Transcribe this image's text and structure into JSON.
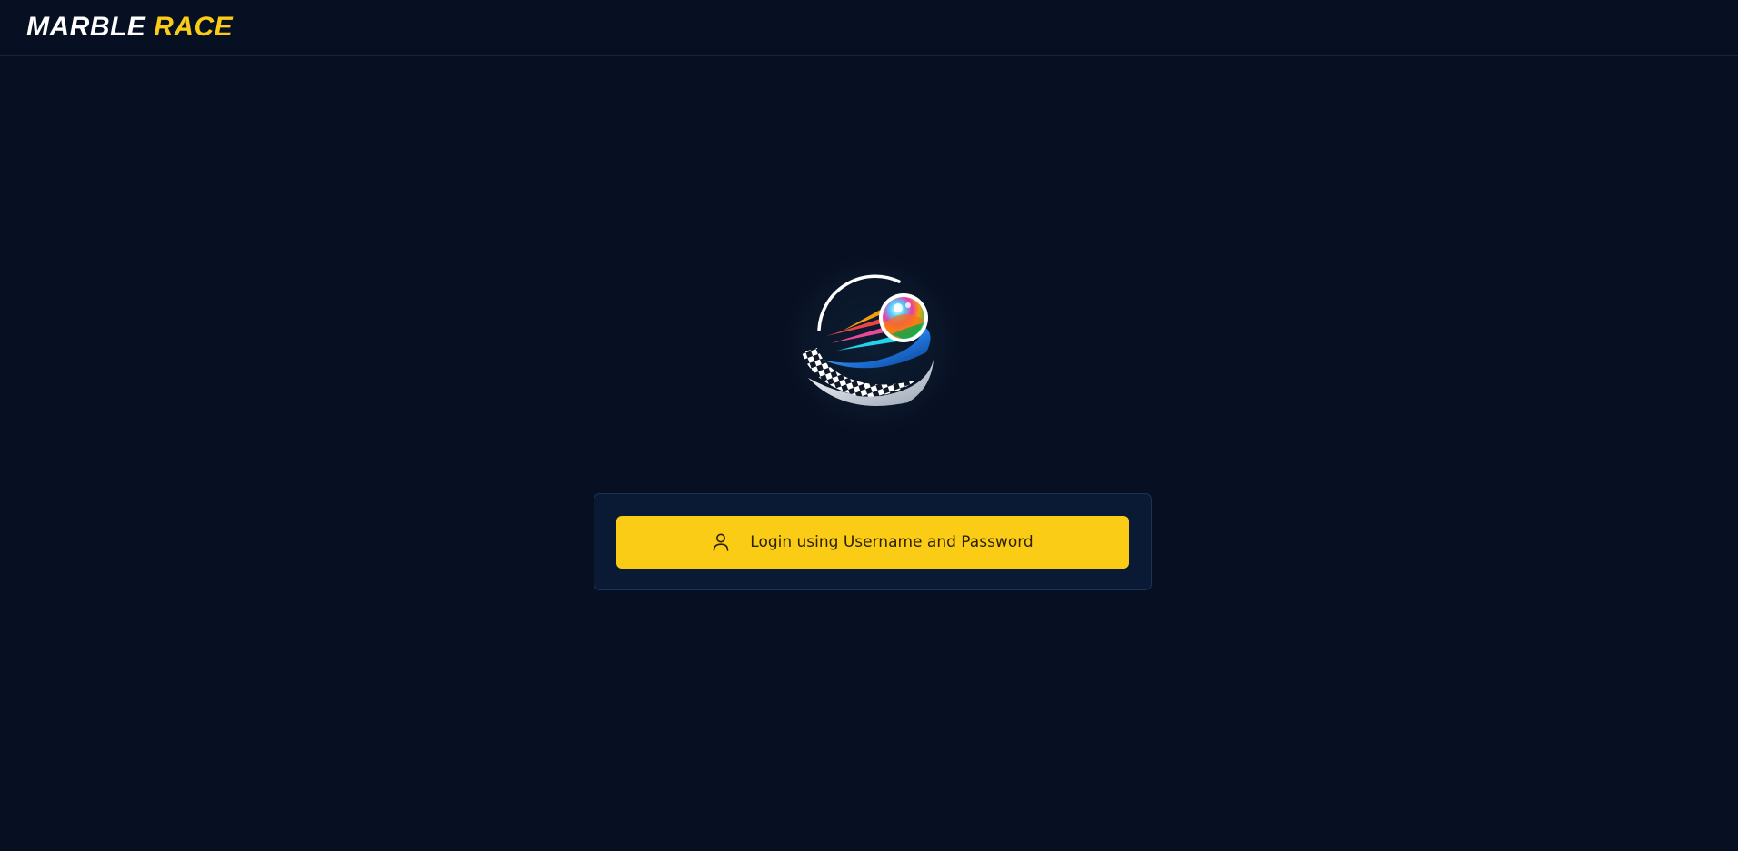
{
  "header": {
    "brand_word1": "MARBLE",
    "brand_word2": "RACE"
  },
  "logo": {
    "icon": "marble-race-logo"
  },
  "login": {
    "button_label": "Login using Username and Password",
    "icon": "user-icon"
  },
  "colors": {
    "background": "#070f22",
    "card": "#0b1a34",
    "accent": "#facc15",
    "brand_white": "#ffffff"
  }
}
